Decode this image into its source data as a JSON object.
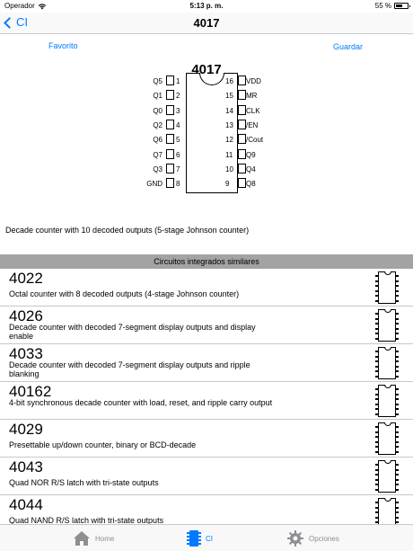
{
  "status_bar": {
    "carrier": "Operador",
    "time": "5:13 p. m.",
    "battery": "55 %",
    "battery_level": 0.55
  },
  "nav": {
    "back_label": "CI",
    "title": "4017"
  },
  "actions": {
    "favorite_label": "Favorito",
    "save_label": "Guardar"
  },
  "chip": {
    "name": "4017",
    "left_pins": [
      {
        "label": "Q5",
        "num": "1"
      },
      {
        "label": "Q1",
        "num": "2"
      },
      {
        "label": "Q0",
        "num": "3"
      },
      {
        "label": "Q2",
        "num": "4"
      },
      {
        "label": "Q6",
        "num": "5"
      },
      {
        "label": "Q7",
        "num": "6"
      },
      {
        "label": "Q3",
        "num": "7"
      },
      {
        "label": "GND",
        "num": "8"
      }
    ],
    "right_pins": [
      {
        "label": "VDD",
        "num": "16"
      },
      {
        "label": "MR",
        "num": "15"
      },
      {
        "label": "CLK",
        "num": "14"
      },
      {
        "label": "/EN",
        "num": "13"
      },
      {
        "label": "/Cout",
        "num": "12"
      },
      {
        "label": "Q9",
        "num": "11"
      },
      {
        "label": "Q4",
        "num": "10"
      },
      {
        "label": "Q8",
        "num": "9"
      }
    ],
    "description": "Decade counter with 10 decoded outputs (5-stage Johnson counter)"
  },
  "similar": {
    "header": "Circuitos integrados similares",
    "items": [
      {
        "code": "4022",
        "desc": "Octal counter with 8 decoded outputs (4-stage Johnson counter)"
      },
      {
        "code": "4026",
        "desc": "Decade counter with decoded 7-segment display outputs and display enable"
      },
      {
        "code": "4033",
        "desc": "Decade counter with decoded 7-segment display outputs and ripple blanking"
      },
      {
        "code": "40162",
        "desc": "4-bit synchronous decade counter with load, reset, and ripple carry output"
      },
      {
        "code": "4029",
        "desc": "Presettable up/down counter, binary or BCD-decade"
      },
      {
        "code": "4043",
        "desc": "Quad NOR R/S latch with tri-state outputs"
      },
      {
        "code": "4044",
        "desc": "Quad NAND R/S latch with tri-state outputs"
      }
    ]
  },
  "tabs": {
    "home": "Home",
    "ci": "CI",
    "options": "Opciones"
  },
  "colors": {
    "accent": "#007aff",
    "section_header": "#a3a3a3",
    "inactive_tab": "#8e8e93"
  }
}
